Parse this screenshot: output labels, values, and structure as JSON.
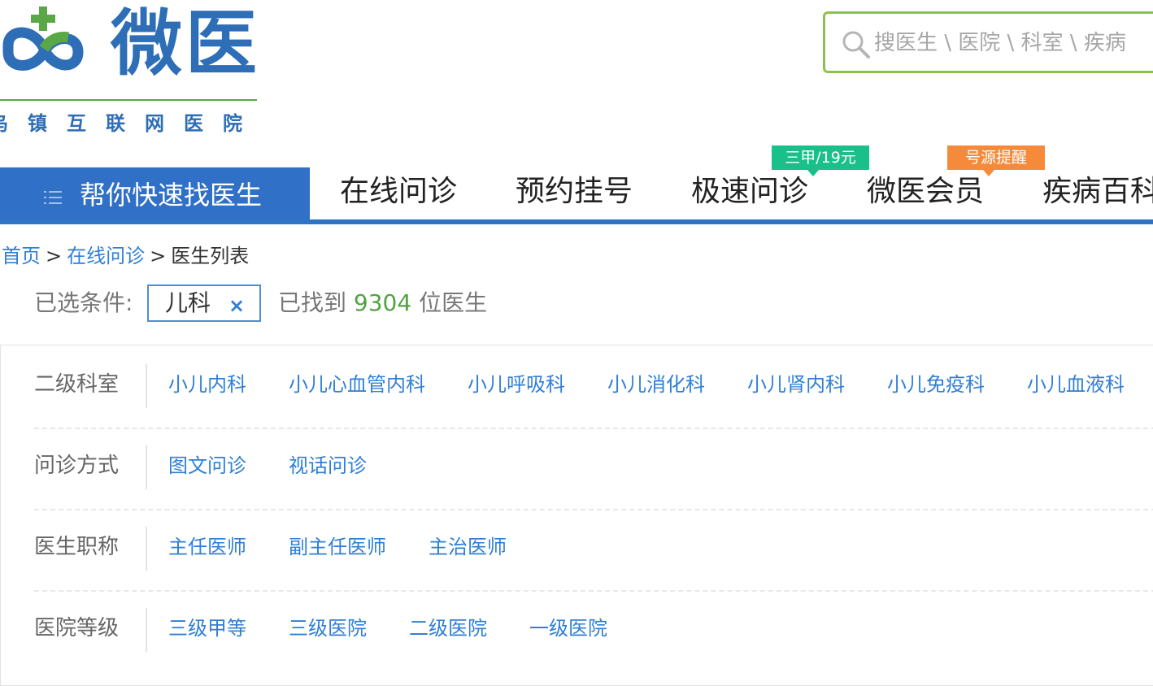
{
  "logo": {
    "title": "微医",
    "subtitle": "乌镇互联网医院",
    "colors": {
      "blue": "#2e6eb6",
      "green": "#5aa746"
    }
  },
  "search": {
    "placeholder": "搜医生 \\ 医院 \\ 科室 \\ 疾病",
    "icon": "search-icon"
  },
  "nav": {
    "find_doctor": {
      "label": "帮你快速找医生",
      "icon": "menu-icon"
    },
    "items": [
      {
        "label": "在线问诊"
      },
      {
        "label": "预约挂号"
      },
      {
        "label": "极速问诊",
        "badge": "三甲/19元",
        "badge_color": "#19c08a"
      },
      {
        "label": "微医会员",
        "badge": "号源提醒",
        "badge_color": "#f58b3a"
      },
      {
        "label": "疾病百科"
      }
    ],
    "accent_color": "#2e73c6"
  },
  "breadcrumb": {
    "items": [
      "首页",
      "在线问诊"
    ],
    "separator": ">",
    "current": "医生列表"
  },
  "selected_filters": {
    "label": "已选条件:",
    "tags": [
      {
        "label": "儿科",
        "close": "×"
      }
    ],
    "result_prefix": "已找到",
    "result_count": "9304",
    "result_suffix": "位医生"
  },
  "filter_panel": {
    "rows": [
      {
        "label": "二级科室",
        "options": [
          "小儿内科",
          "小儿心血管内科",
          "小儿呼吸科",
          "小儿消化科",
          "小儿肾内科",
          "小儿免疫科",
          "小儿血液科"
        ]
      },
      {
        "label": "问诊方式",
        "options": [
          "图文问诊",
          "视话问诊"
        ]
      },
      {
        "label": "医生职称",
        "options": [
          "主任医师",
          "副主任医师",
          "主治医师"
        ]
      },
      {
        "label": "医院等级",
        "options": [
          "三级甲等",
          "三级医院",
          "二级医院",
          "一级医院"
        ]
      }
    ]
  }
}
